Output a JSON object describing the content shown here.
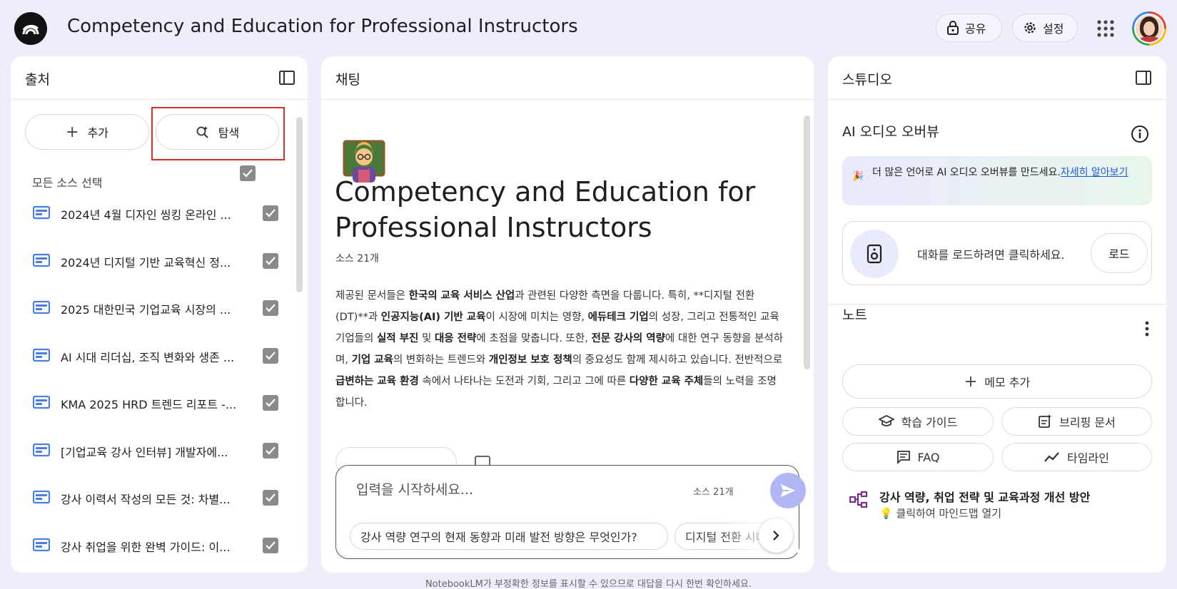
{
  "header": {
    "title": "Competency and Education for Professional Instructors",
    "share_label": "공유",
    "settings_label": "설정"
  },
  "sources": {
    "title": "출처",
    "add_label": "추가",
    "discover_label": "탐색",
    "select_all_label": "모든 소스 선택",
    "items": [
      {
        "label": "2024년 4월 디자인 씽킹 온라인 ..."
      },
      {
        "label": "2024년 디지털 기반 교육혁신 정..."
      },
      {
        "label": "2025 대한민국 기업교육 시장의 ..."
      },
      {
        "label": "AI 시대 리더십, 조직 변화와 생존 ..."
      },
      {
        "label": "KMA 2025 HRD 트렌드 리포트 -..."
      },
      {
        "label": "[기업교육 강사 인터뷰] 개발자에..."
      },
      {
        "label": "강사 이력서 작성의 모든 것: 차별..."
      },
      {
        "label": "강사 취업을 위한 완벽 가이드: 이..."
      }
    ]
  },
  "chat": {
    "title": "채팅",
    "notebook_title": "Competency and Education for Professional Instructors",
    "source_count": "소스 21개",
    "summary": {
      "p1": "제공된 문서들은 ",
      "b1": "한국의 교육 서비스 산업",
      "p2": "과 관련된 다양한 측면을 다룹니다. 특히, **디지털 전환(DT)**과 ",
      "b2": "인공지능(AI) 기반 교육",
      "p3": "이 시장에 미치는 영향, ",
      "b3": "에듀테크 기업",
      "p4": "의 성장, 그리고 전통적인 교육 기업들의 ",
      "b4": "실적 부진",
      "p5": " 및 ",
      "b5": "대응 전략",
      "p6": "에 초점을 맞춥니다. 또한, ",
      "b6": "전문 강사의 역량",
      "p7": "에 대한 연구 동향을 분석하며, ",
      "b7": "기업 교육",
      "p8": "의 변화하는 트렌드와 ",
      "b8": "개인정보 보호 정책",
      "p9": "의 중요성도 함께 제시하고 있습니다. 전반적으로 ",
      "b9": "급변하는 교육 환경",
      "p10": " 속에서 나타나는 도전과 기회, 그리고 그에 따른 ",
      "b10": "다양한 교육 주체",
      "p11": "들의 노력을 조명합니다."
    },
    "input_placeholder": "입력을 시작하세요...",
    "input_source_count": "소스 21개",
    "suggestions": [
      "강사 역량 연구의 현재 동향과 미래 발전 방향은 무엇인가?",
      "디지털 전환 시대"
    ]
  },
  "studio": {
    "title": "스튜디오",
    "audio_title": "AI 오디오 오버뷰",
    "promo_text": "더 많은 언어로 AI 오디오 오버뷰를 만드세요.",
    "promo_link": "자세히 알아보기",
    "audio_text": "대화를 로드하려면 클릭하세요.",
    "load_label": "로드",
    "notes_title": "노트",
    "add_memo_label": "메모 추가",
    "study_guide_label": "학습 가이드",
    "briefing_label": "브리핑 문서",
    "faq_label": "FAQ",
    "timeline_label": "타임라인",
    "note": {
      "title": "강사 역량, 취업 전략 및 교육과정 개선 방안",
      "subtitle": "클릭하여 마인드맵 열기"
    }
  },
  "footer": "NotebookLM가 부정확한 정보를 표시할 수 있으므로 대답을 다시 한번 확인하세요.",
  "colors": {
    "background": "#eeeefb",
    "accent": "#b3b6f5",
    "doc_icon": "#4a7fe0",
    "highlight_box": "#d93025",
    "mindmap_icon": "#7b2a8f"
  }
}
